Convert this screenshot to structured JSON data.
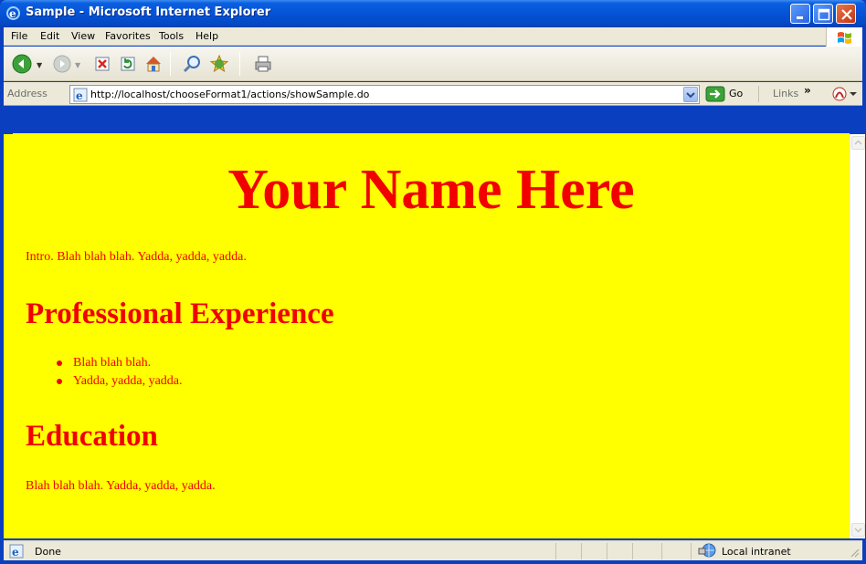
{
  "window": {
    "title": "Sample - Microsoft Internet Explorer"
  },
  "menu": {
    "items": [
      "File",
      "Edit",
      "View",
      "Favorites",
      "Tools",
      "Help"
    ]
  },
  "toolbar": {
    "buttons": [
      {
        "name": "back-icon"
      },
      {
        "name": "forward-icon"
      },
      {
        "name": "stop-icon"
      },
      {
        "name": "refresh-icon"
      },
      {
        "name": "home-icon"
      },
      {
        "name": "search-icon"
      },
      {
        "name": "favorites-icon"
      },
      {
        "name": "print-icon"
      }
    ]
  },
  "address": {
    "label": "Address",
    "url": "http://localhost/chooseFormat1/actions/showSample.do",
    "go_label": "Go",
    "links_label": "Links",
    "links_more": "»"
  },
  "page": {
    "heading": "Your Name Here",
    "intro": "Intro. Blah blah blah. Yadda, yadda, yadda.",
    "experience_heading": "Professional Experience",
    "experience_items": [
      "Blah blah blah.",
      "Yadda, yadda, yadda."
    ],
    "education_heading": "Education",
    "education_text": "Blah blah blah. Yadda, yadda, yadda.",
    "background_color": "#ffff00",
    "text_color": "#f20000"
  },
  "status": {
    "text": "Done",
    "zone": "Local intranet"
  }
}
